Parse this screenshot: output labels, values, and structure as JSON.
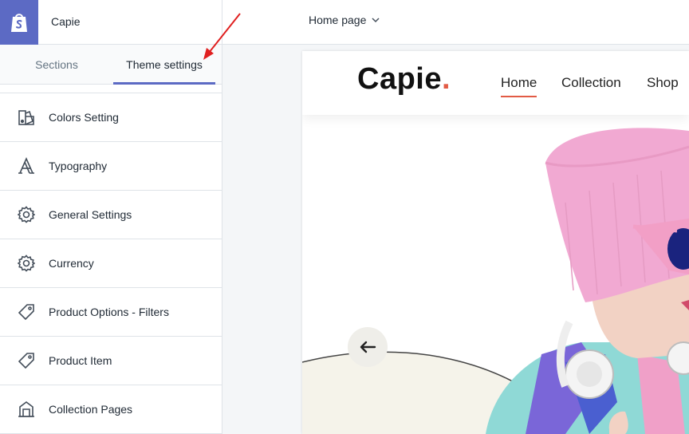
{
  "topbar": {
    "store_name": "Capie",
    "page_selector": "Home page"
  },
  "sidebar": {
    "tabs": [
      {
        "label": "Sections"
      },
      {
        "label": "Theme settings"
      }
    ],
    "items": [
      {
        "label": "Colors Setting",
        "icon": "colors-icon"
      },
      {
        "label": "Typography",
        "icon": "typography-icon"
      },
      {
        "label": "General Settings",
        "icon": "gear-icon"
      },
      {
        "label": "Currency",
        "icon": "gear-icon"
      },
      {
        "label": "Product Options - Filters",
        "icon": "tag-icon"
      },
      {
        "label": "Product Item",
        "icon": "tag-icon"
      },
      {
        "label": "Collection Pages",
        "icon": "collection-icon"
      }
    ]
  },
  "preview": {
    "brand": "Capie",
    "brand_dot": ".",
    "nav": [
      {
        "label": "Home"
      },
      {
        "label": "Collection"
      },
      {
        "label": "Shop"
      }
    ]
  },
  "colors": {
    "accent": "#5c6ac4",
    "brand_dot": "#e25b45",
    "annotation_arrow": "#e02020"
  }
}
